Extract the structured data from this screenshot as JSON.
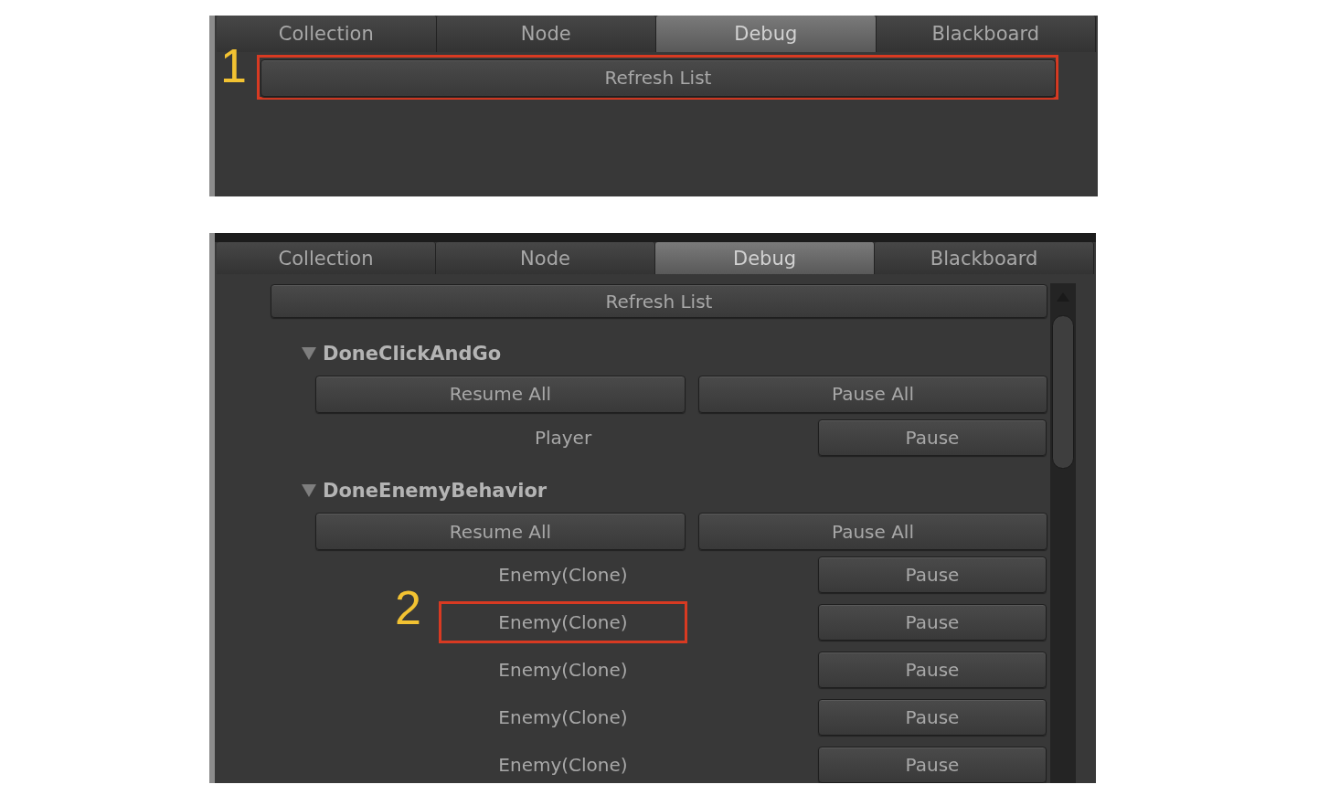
{
  "panels": [
    {
      "tabs": [
        {
          "label": "Collection",
          "selected": false
        },
        {
          "label": "Node",
          "selected": false
        },
        {
          "label": "Debug",
          "selected": true
        },
        {
          "label": "Blackboard",
          "selected": false
        }
      ],
      "refresh_button": {
        "label": "Refresh List",
        "callout": "1"
      }
    },
    {
      "tabs": [
        {
          "label": "Collection",
          "selected": false
        },
        {
          "label": "Node",
          "selected": false
        },
        {
          "label": "Debug",
          "selected": true
        },
        {
          "label": "Blackboard",
          "selected": false
        }
      ],
      "refresh_button": {
        "label": "Refresh List"
      },
      "groups": [
        {
          "title": "DoneClickAndGo",
          "expanded": true,
          "resume_all": "Resume All",
          "pause_all": "Pause All",
          "items": [
            {
              "name": "Player",
              "button": "Pause"
            }
          ]
        },
        {
          "title": "DoneEnemyBehavior",
          "expanded": true,
          "resume_all": "Resume All",
          "pause_all": "Pause All",
          "items": [
            {
              "name": "Enemy(Clone)",
              "button": "Pause"
            },
            {
              "name": "Enemy(Clone)",
              "button": "Pause",
              "callout": "2"
            },
            {
              "name": "Enemy(Clone)",
              "button": "Pause"
            },
            {
              "name": "Enemy(Clone)",
              "button": "Pause"
            },
            {
              "name": "Enemy(Clone)",
              "button": "Pause"
            }
          ]
        }
      ]
    }
  ]
}
